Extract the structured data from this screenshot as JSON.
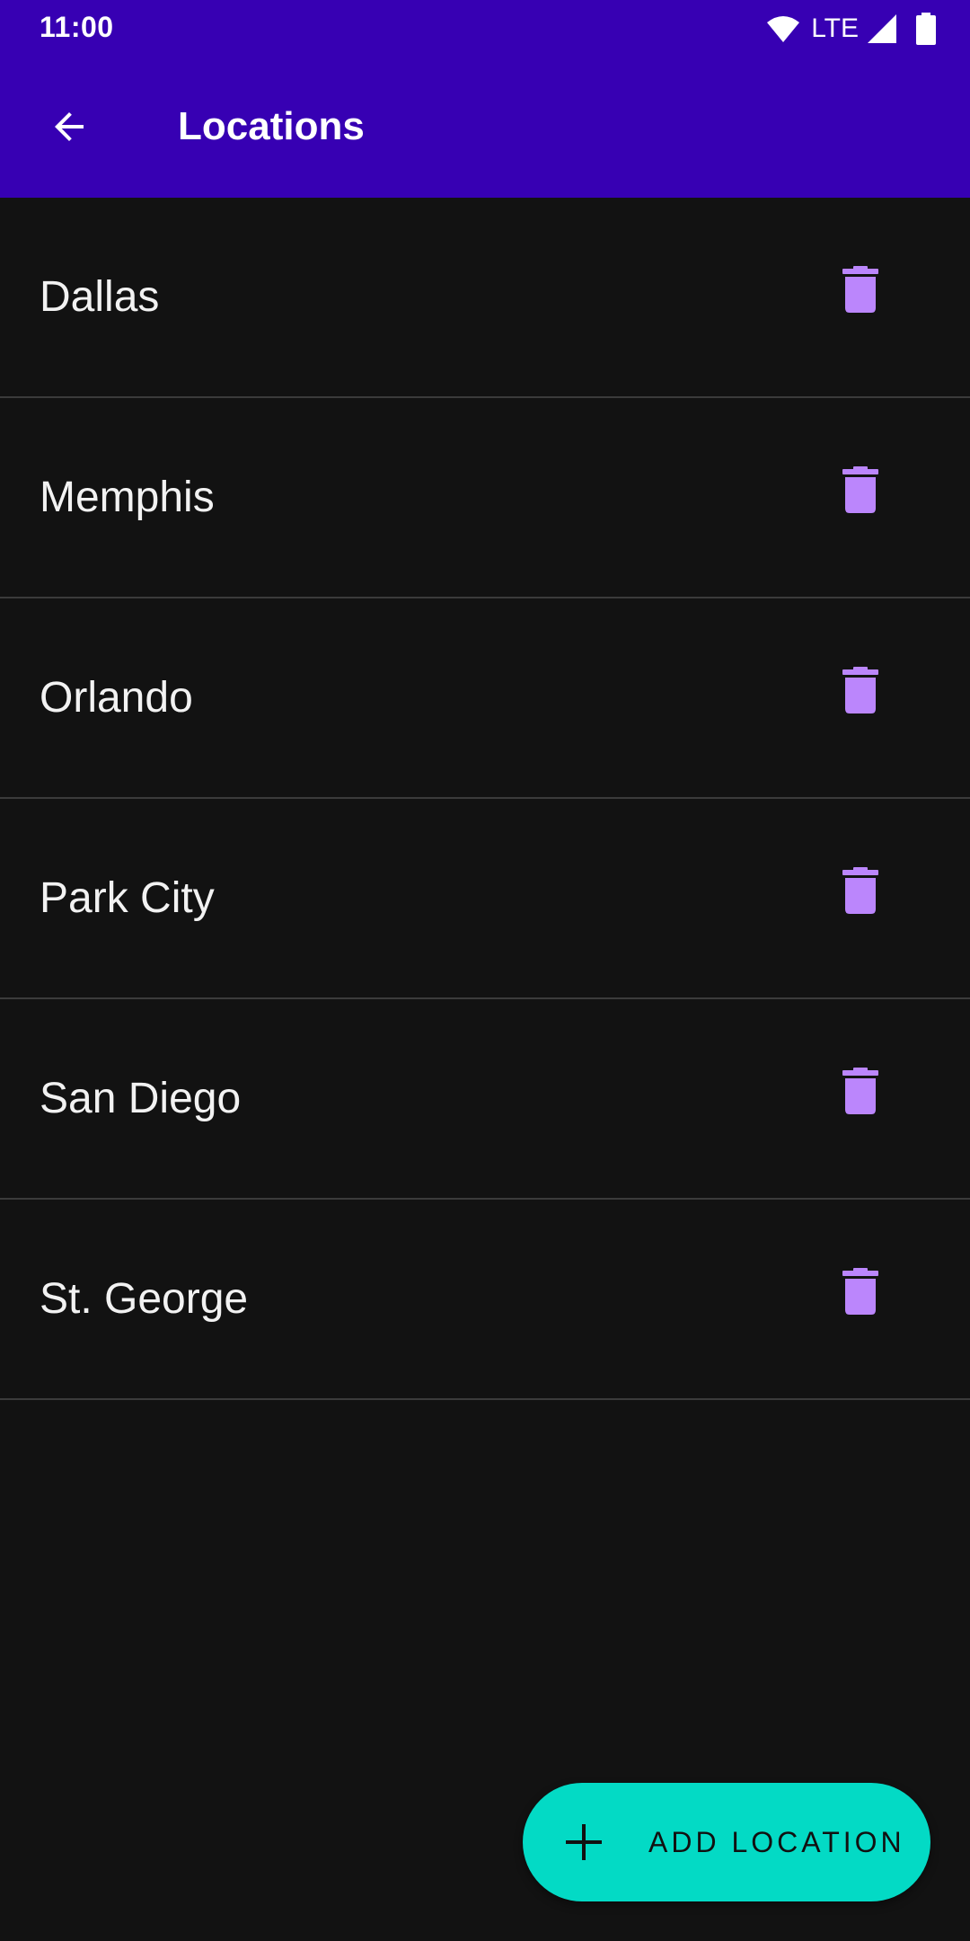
{
  "status_bar": {
    "time": "11:00",
    "network": "LTE",
    "icons": [
      "wifi-icon",
      "cell-signal-icon",
      "battery-icon"
    ]
  },
  "app_bar": {
    "title": "Locations",
    "back_icon": "arrow-back-icon"
  },
  "locations": [
    {
      "name": "Dallas"
    },
    {
      "name": "Memphis"
    },
    {
      "name": "Orlando"
    },
    {
      "name": "Park City"
    },
    {
      "name": "San Diego"
    },
    {
      "name": "St. George"
    }
  ],
  "item_action_icon": "trash-icon",
  "fab": {
    "label": "ADD LOCATION",
    "icon": "plus-icon"
  },
  "colors": {
    "primary": "#3700b3",
    "background": "#121212",
    "accent": "#bb86fc",
    "secondary": "#03dac5",
    "divider": "#3b3b3b"
  }
}
